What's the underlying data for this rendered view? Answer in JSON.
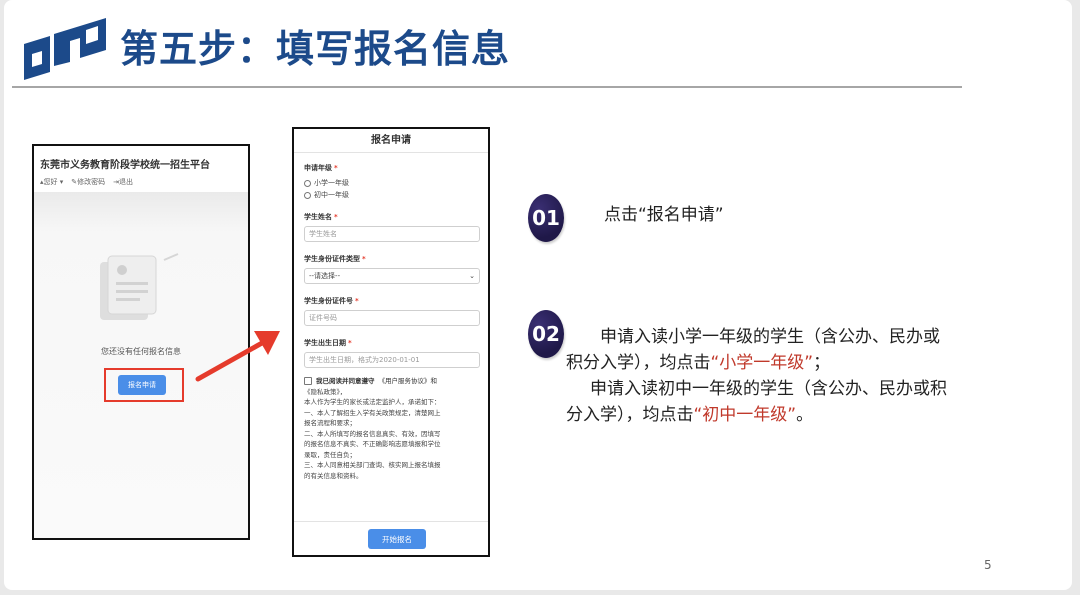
{
  "title": "第五步：填写报名信息",
  "page_number": "5",
  "colors": {
    "title": "#1c4a8a",
    "highlight": "#c0392b",
    "badge": "#2a2160",
    "button": "#4a8ee8",
    "frame": "#e53b2c"
  },
  "left_screen": {
    "platform_title": "东莞市义务教育阶段学校统一招生平台",
    "user_greeting": "您好",
    "change_password": "修改密码",
    "logout": "退出",
    "empty_message": "您还没有任何报名信息",
    "apply_button": "报名申请"
  },
  "right_screen": {
    "header": "报名申请",
    "grade_label": "申请年级",
    "grade_options": [
      "小学一年级",
      "初中一年级"
    ],
    "name_label": "学生姓名",
    "name_placeholder": "学生姓名",
    "id_type_label": "学生身份证件类型",
    "id_type_value": "--请选择--",
    "id_number_label": "学生身份证件号",
    "id_number_placeholder": "证件号码",
    "birth_label": "学生出生日期",
    "birth_placeholder": "学生出生日期，格式为2020-01-01",
    "agreement_head": "我已阅读并同意遵守",
    "agreement_link": "《用户服务协议》和",
    "agreement_lines": [
      "《隐私政策》，",
      "本人作为学生的家长或法定监护人，承诺如下：",
      "一、本人了解招生入学有关政策规定，清楚网上",
      "报名流程和要求；",
      "二、本人所填写的报名信息真实、有效，因填写",
      "的报名信息不真实、不正确影响志愿填报和学位",
      "录取，责任自负；",
      "三、本人同意相关部门查询、核实网上报名填报",
      "的有关信息和资料。"
    ],
    "start_button": "开始报名"
  },
  "steps": [
    {
      "number": "01",
      "text": "点击“报名申请”"
    },
    {
      "number": "02",
      "line1": "申请入读小学一年级的学生（含公办、民办或",
      "line2a": "积分入学），均点击",
      "line2b": "“小学一年级”",
      "line2c": "；",
      "line3": "申请入读初中一年级的学生（含公办、民办或积",
      "line4a": "分入学），均点击",
      "line4b": "“初中一年级”",
      "line4c": "。"
    }
  ]
}
